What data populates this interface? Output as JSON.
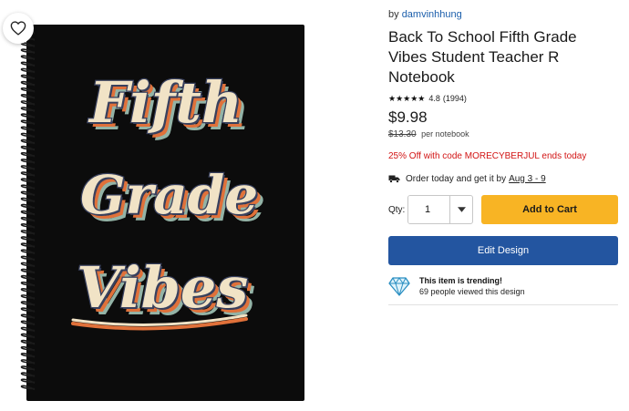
{
  "product": {
    "byline_prefix": "by",
    "seller": "damvinhhung",
    "title": "Back To School Fifth Grade Vibes Student Teacher R Notebook",
    "rating_score": "4.8",
    "rating_count": "(1994)",
    "stars": "★★★★★",
    "price": "$9.98",
    "old_price": "$13.30",
    "per_unit": "per notebook",
    "promo": "25% Off with code MORECYBERJUL ends today",
    "delivery_text": "Order today and get it by",
    "delivery_date": "Aug 3 - 9",
    "qty_label": "Qty:",
    "qty_value": "1",
    "add_to_cart": "Add to Cart",
    "edit_design": "Edit Design",
    "trending_title": "This item is trending!",
    "trending_detail": "69 people viewed this design"
  },
  "artwork": {
    "words": [
      "Fifth",
      "Grade",
      "Vibes"
    ]
  },
  "icons": {
    "favorite": "heart-icon",
    "delivery": "truck-icon",
    "qty_dropdown": "caret-down-icon",
    "trending": "diamond-icon"
  },
  "colors": {
    "cart_button": "#f8b424",
    "edit_button": "#2355a0",
    "promo": "#d21414",
    "link": "#1b5eab",
    "notebook": "#0c0c0c",
    "text_cream": "#f1e3c6",
    "text_outline": "#39415e",
    "shadow_orange": "#e0713a",
    "shadow_teal": "#93b3a6"
  }
}
